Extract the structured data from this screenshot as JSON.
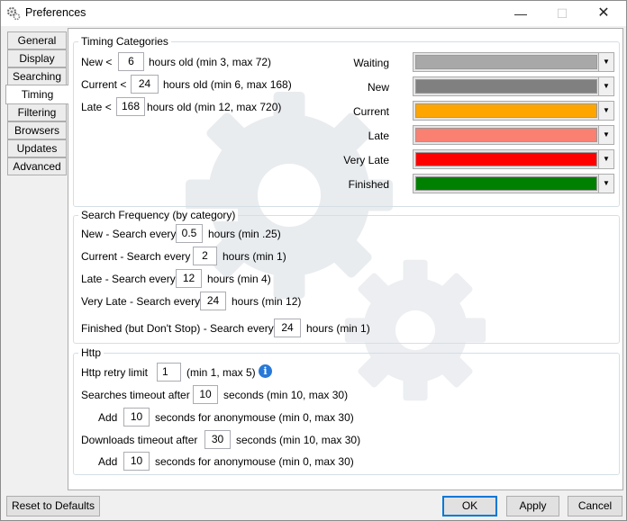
{
  "window": {
    "title": "Preferences"
  },
  "tabs": [
    "General",
    "Display",
    "Searching",
    "Timing",
    "Filtering",
    "Browsers",
    "Updates",
    "Advanced"
  ],
  "active_tab": "Timing",
  "timing_categories": {
    "title": "Timing Categories",
    "rows": [
      {
        "prefix": "New <",
        "value": "6",
        "suffix": "hours old (min 3, max 72)"
      },
      {
        "prefix": "Current <",
        "value": "24",
        "suffix": "hours old (min 6, max 168)"
      },
      {
        "prefix": "Late <",
        "value": "168",
        "suffix": "hours old (min 12, max 720)"
      }
    ],
    "colors": [
      {
        "label": "Waiting",
        "color": "#a8a8a8"
      },
      {
        "label": "New",
        "color": "#808080"
      },
      {
        "label": "Current",
        "color": "#ffa500"
      },
      {
        "label": "Late",
        "color": "#fa8072"
      },
      {
        "label": "Very Late",
        "color": "#ff0000"
      },
      {
        "label": "Finished",
        "color": "#008000"
      }
    ]
  },
  "search_frequency": {
    "title": "Search Frequency (by category)",
    "rows": [
      {
        "prefix": "New - Search every",
        "value": "0.5",
        "suffix": "hours (min .25)"
      },
      {
        "prefix": "Current - Search every",
        "value": "2",
        "suffix": "hours (min 1)"
      },
      {
        "prefix": "Late - Search every",
        "value": "12",
        "suffix": "hours (min 4)"
      },
      {
        "prefix": "Very Late - Search every",
        "value": "24",
        "suffix": "hours (min 12)"
      },
      {
        "prefix": "Finished (but Don't Stop) - Search every",
        "value": "24",
        "suffix": "hours (min 1)"
      }
    ]
  },
  "http": {
    "title": "Http",
    "retry": {
      "prefix": "Http retry limit",
      "value": "1",
      "suffix": "(min 1, max 5)"
    },
    "search_timeout": {
      "prefix": "Searches timeout after",
      "value": "10",
      "suffix": "seconds (min 10, max 30)"
    },
    "search_add": {
      "prefix": "Add",
      "value": "10",
      "suffix": "seconds for anonymouse (min 0, max 30)"
    },
    "download_timeout": {
      "prefix": "Downloads timeout after",
      "value": "30",
      "suffix": "seconds (min 10, max 30)"
    },
    "download_add": {
      "prefix": "Add",
      "value": "10",
      "suffix": "seconds for anonymouse (min 0, max 30)"
    }
  },
  "buttons": {
    "reset": "Reset to Defaults",
    "ok": "OK",
    "apply": "Apply",
    "cancel": "Cancel"
  },
  "icons": {
    "app": "gears-icon",
    "info": "info-icon",
    "dropdown": "chevron-down-icon"
  }
}
